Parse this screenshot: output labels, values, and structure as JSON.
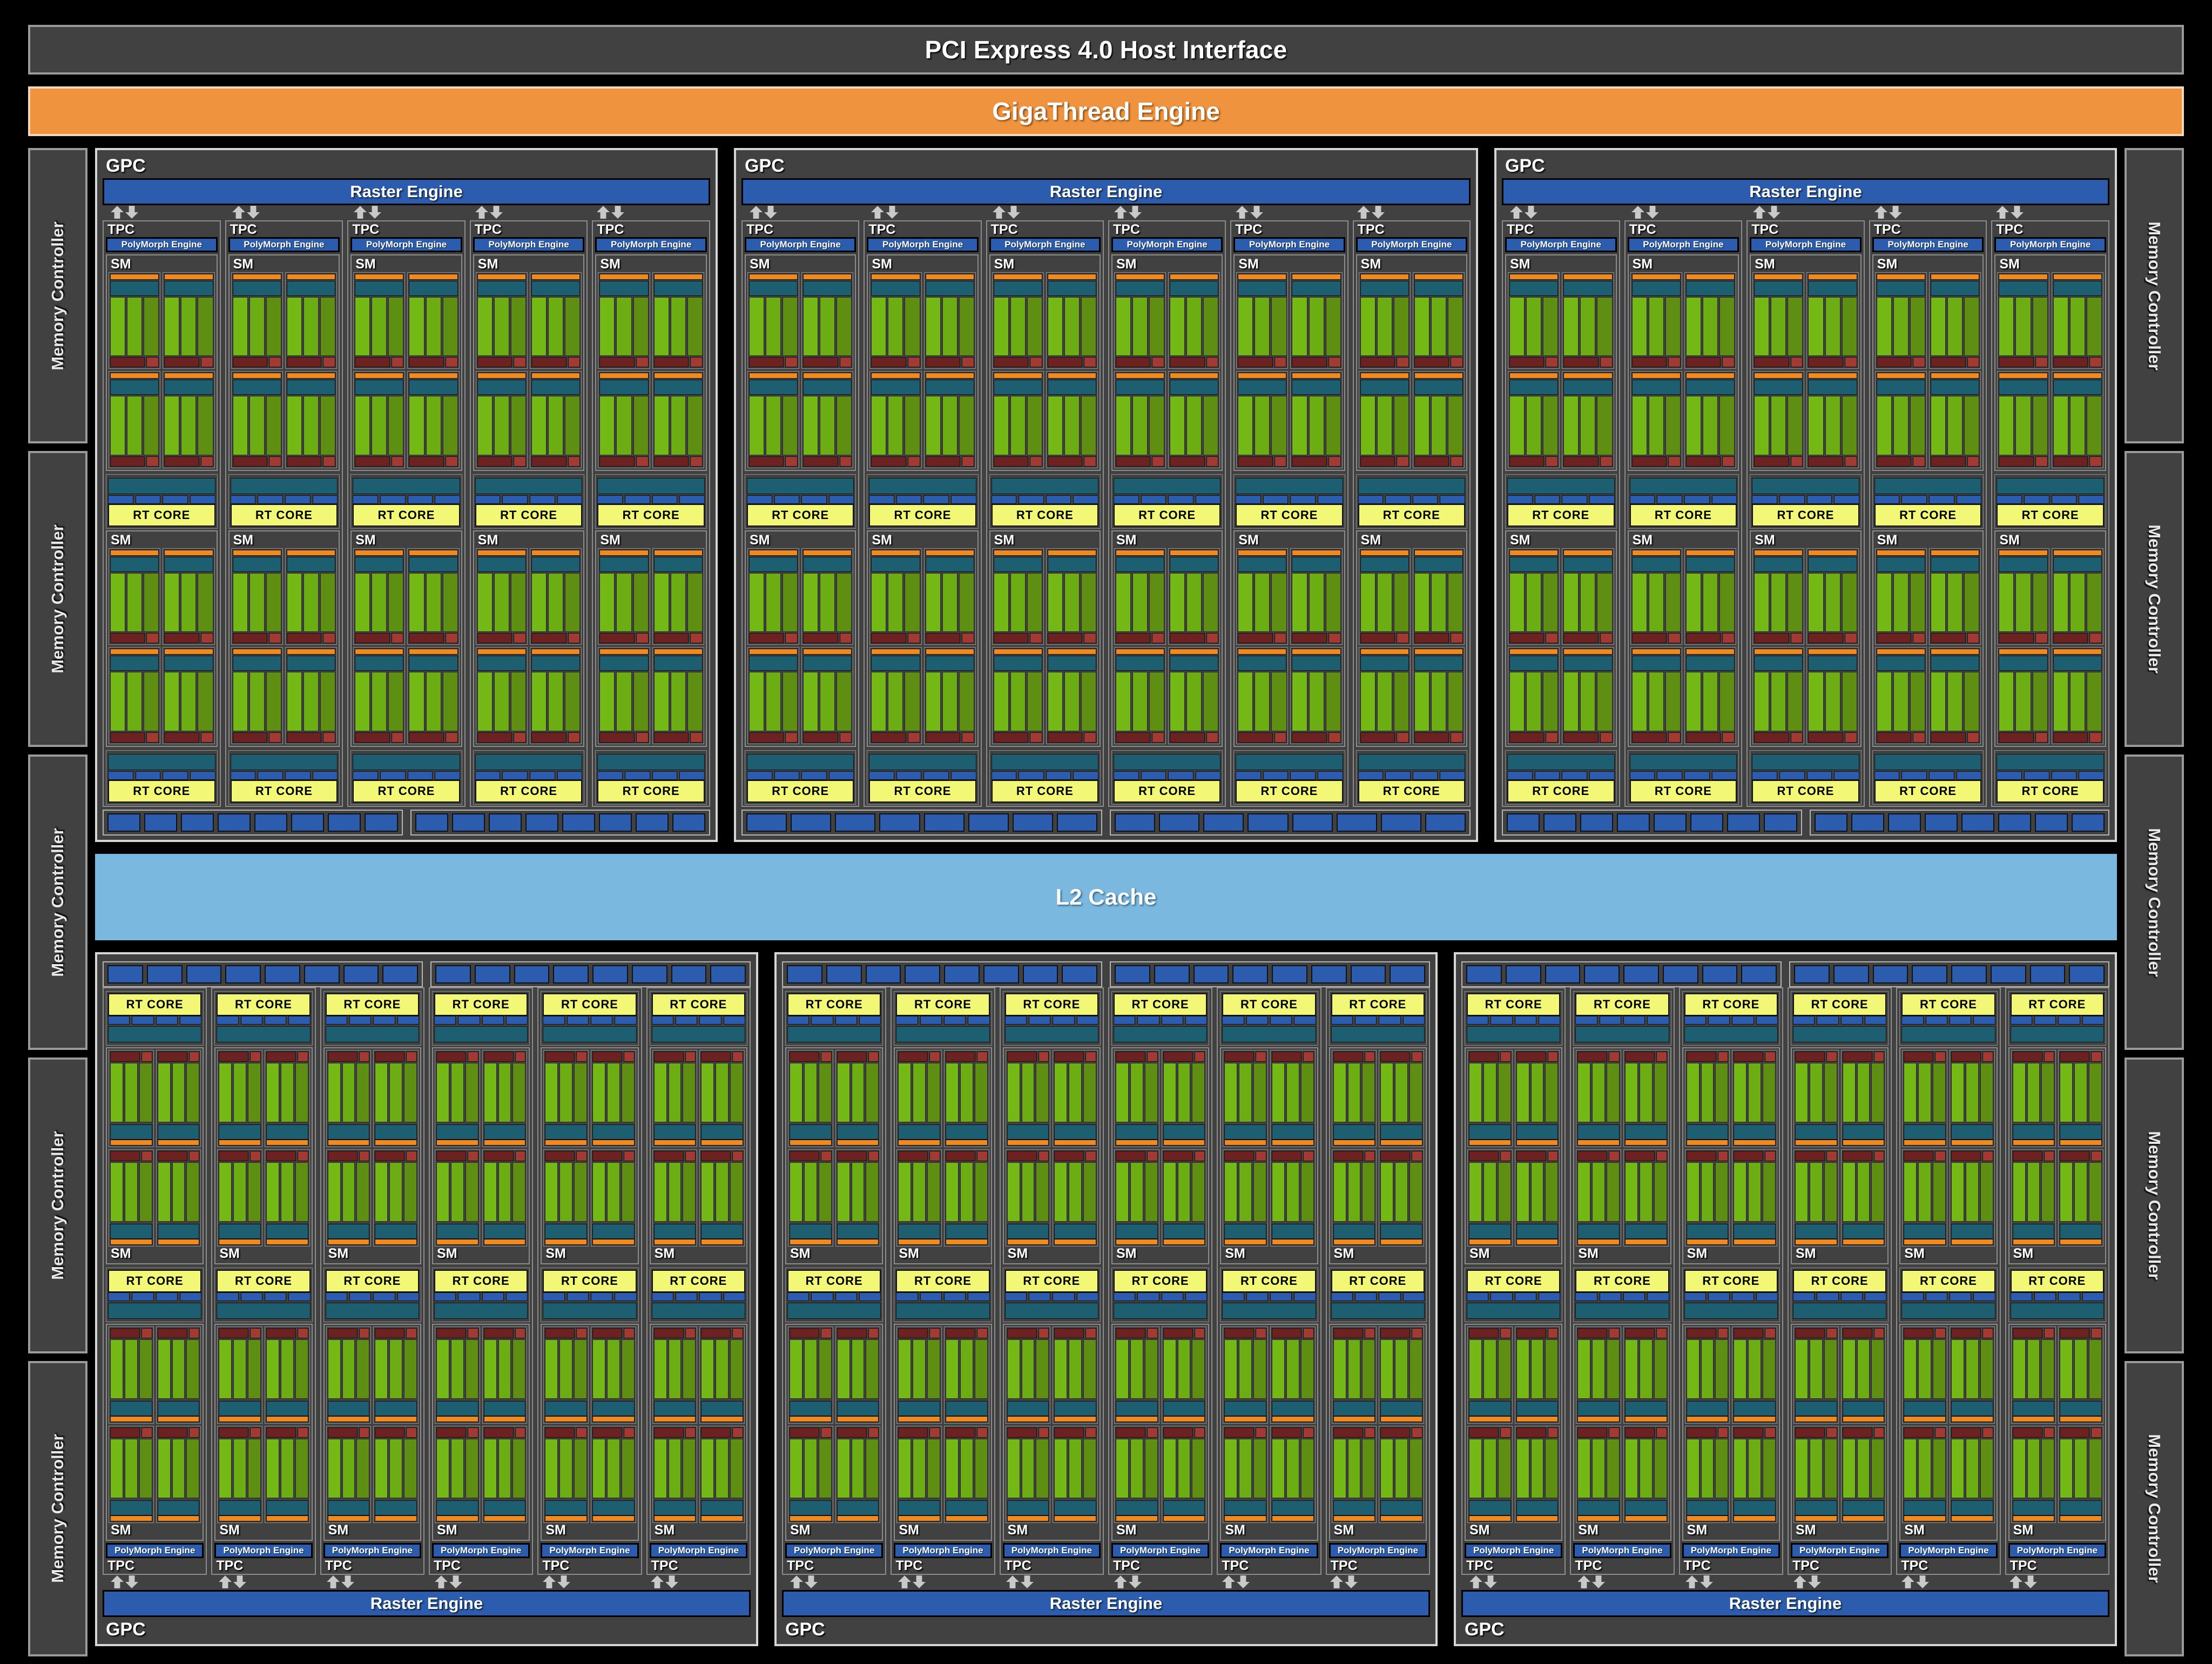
{
  "header": {
    "host_interface": "PCI Express 4.0 Host Interface",
    "gigathread": "GigaThread Engine"
  },
  "cache": {
    "l2_label": "L2 Cache"
  },
  "labels": {
    "gpc": "GPC",
    "tpc": "TPC",
    "sm": "SM",
    "raster_engine": "Raster Engine",
    "polymorph_engine": "PolyMorph Engine",
    "rt_core": "RT CORE",
    "memory_controller": "Memory Controller"
  },
  "colors": {
    "background": "#000000",
    "panel": "#414141",
    "panel_border": "#d6d6d6",
    "blue": "#2b5cad",
    "orange": "#f08a1e",
    "gigathread_orange": "#f0933f",
    "teal": "#1d5f70",
    "green_light": "#74b816",
    "green_dark": "#5f8f12",
    "red_dark": "#6b2220",
    "red_light": "#a03a32",
    "rt_core_yellow": "#f2f776",
    "l2_blue": "#7ab8e0"
  },
  "memory_controllers": {
    "left_count": 5,
    "right_count": 5,
    "label": "Memory Controller"
  },
  "gpc_top": [
    {
      "tpc_count": 5,
      "sm_per_tpc": 2,
      "rop_groups": 2,
      "rops_per_group": 8
    },
    {
      "tpc_count": 6,
      "sm_per_tpc": 2,
      "rop_groups": 2,
      "rops_per_group": 8
    },
    {
      "tpc_count": 5,
      "sm_per_tpc": 2,
      "rop_groups": 2,
      "rops_per_group": 8
    }
  ],
  "gpc_bottom": [
    {
      "tpc_count": 6,
      "sm_per_tpc": 2,
      "rop_groups": 2,
      "rops_per_group": 8
    },
    {
      "tpc_count": 6,
      "sm_per_tpc": 2,
      "rop_groups": 2,
      "rops_per_group": 8
    },
    {
      "tpc_count": 6,
      "sm_per_tpc": 2,
      "rop_groups": 2,
      "rops_per_group": 8
    }
  ],
  "sm_partition": {
    "count_per_sm": 4,
    "green_columns": 3,
    "tex_units": 4
  }
}
